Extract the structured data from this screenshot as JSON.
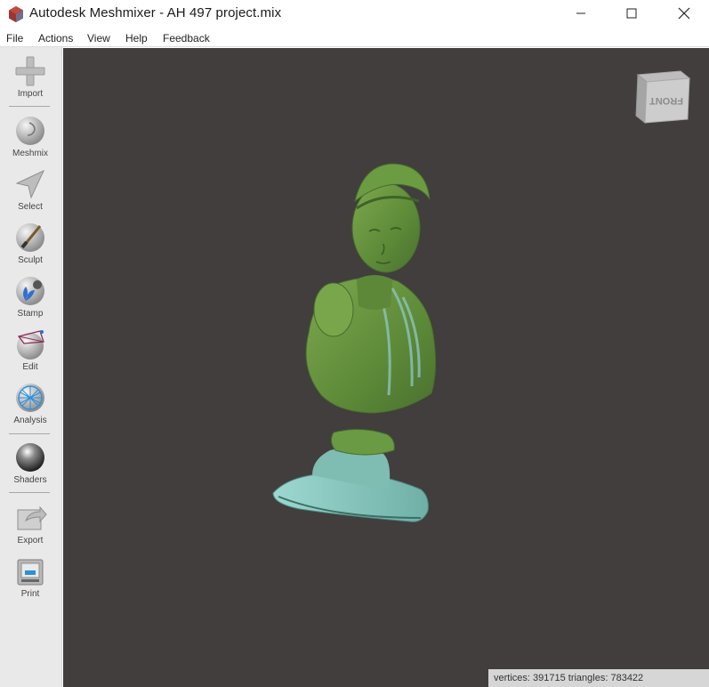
{
  "window": {
    "title": "Autodesk Meshmixer - AH 497 project.mix",
    "controls": [
      "minimize",
      "maximize",
      "close"
    ]
  },
  "menu": [
    "File",
    "Actions",
    "View",
    "Help",
    "Feedback"
  ],
  "toolbar": [
    {
      "label": "Import",
      "icon": "plus-icon"
    },
    {
      "label": "Meshmix",
      "icon": "meshmix-icon"
    },
    {
      "label": "Select",
      "icon": "arrow-icon"
    },
    {
      "label": "Sculpt",
      "icon": "brush-icon"
    },
    {
      "label": "Stamp",
      "icon": "stamp-icon"
    },
    {
      "label": "Edit",
      "icon": "edit-icon"
    },
    {
      "label": "Analysis",
      "icon": "analysis-icon"
    },
    {
      "label": "Shaders",
      "icon": "shader-sphere-icon"
    },
    {
      "label": "Export",
      "icon": "export-icon"
    },
    {
      "label": "Print",
      "icon": "printer-icon"
    }
  ],
  "viewport": {
    "viewcube_face": "FRONT",
    "status": "vertices: 391715 triangles: 783422",
    "background": "#413e3d",
    "model_colors": [
      "#6f9a45",
      "#8cc9c0"
    ]
  }
}
